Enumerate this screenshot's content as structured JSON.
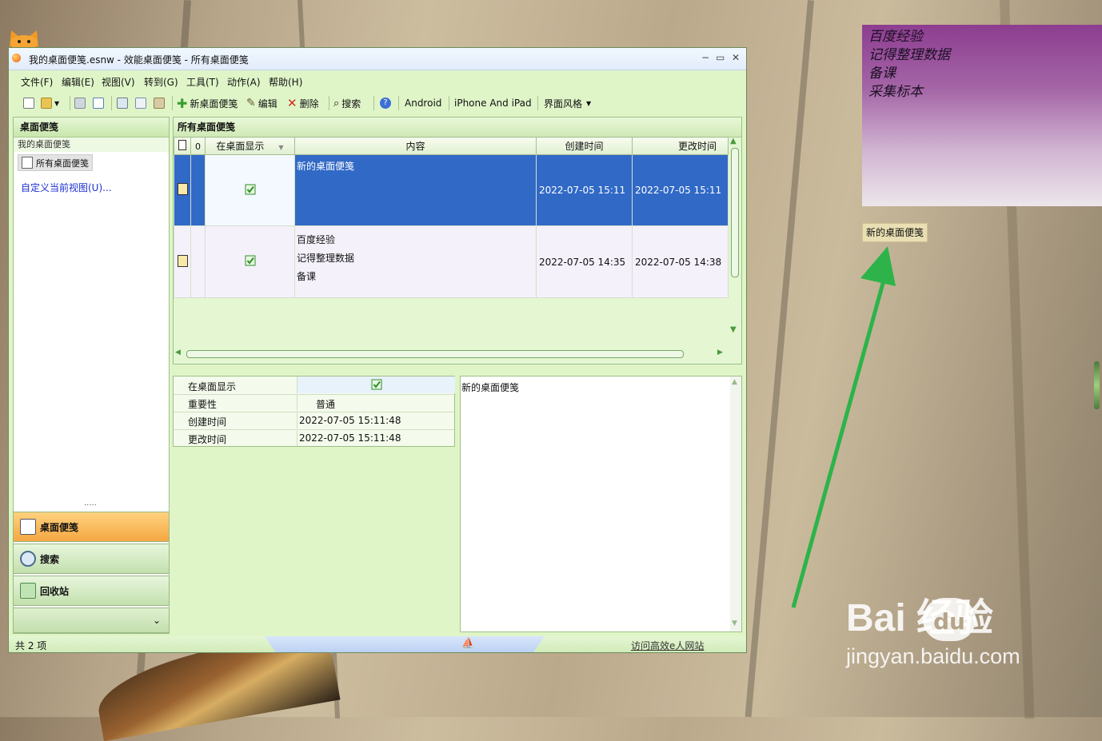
{
  "window": {
    "title": "我的桌面便笺.esnw - 效能桌面便笺 - 所有桌面便笺",
    "buttons": {
      "minimize": "−",
      "maximize": "▭",
      "close": "✕"
    }
  },
  "menu": [
    "文件(F)",
    "编辑(E)",
    "视图(V)",
    "转到(G)",
    "工具(T)",
    "动作(A)",
    "帮助(H)"
  ],
  "toolbar": {
    "new_label": "新桌面便笺",
    "edit_label": "编辑",
    "delete_label": "删除",
    "search_label": "搜索",
    "android_label": "Android",
    "iphone_label": "iPhone And iPad",
    "theme_label": "界面风格",
    "colors": {
      "new": "#3a9e2e",
      "delete": "#d62b1e",
      "help": "#3d6fd6"
    }
  },
  "nav": {
    "header": "桌面便笺",
    "group": "我的桌面便笺",
    "current": "所有桌面便笺",
    "customize_link": "自定义当前视图(U)...",
    "grip": "·····",
    "buttons": [
      {
        "label": "桌面便笺",
        "icon": "note-icon",
        "active": true
      },
      {
        "label": "搜索",
        "icon": "search-icon",
        "active": false
      },
      {
        "label": "回收站",
        "icon": "recycle-bin-icon",
        "active": false
      }
    ],
    "more_arrow": "⌄"
  },
  "panel": {
    "title": "所有桌面便笺",
    "columns": {
      "show": "在桌面显示",
      "content": "内容",
      "created": "创建时间",
      "modified": "更改时间"
    },
    "rows": [
      {
        "content": [
          "新的桌面便笺"
        ],
        "created": "2022-07-05 15:11",
        "modified": "2022-07-05 15:11",
        "show_on_desktop": true,
        "selected": true
      },
      {
        "content": [
          "百度经验",
          "记得整理数据",
          "备课"
        ],
        "created": "2022-07-05 14:35",
        "modified": "2022-07-05 14:38",
        "show_on_desktop": true,
        "selected": false
      }
    ]
  },
  "properties": {
    "rows": [
      {
        "key": "在桌面显示",
        "value": ""
      },
      {
        "key": "重要性",
        "value": "普通"
      },
      {
        "key": "创建时间",
        "value": "2022-07-05 15:11:48"
      },
      {
        "key": "更改时间",
        "value": "2022-07-05 15:11:48"
      }
    ]
  },
  "editor": {
    "text": "新的桌面便笺"
  },
  "status": {
    "count": "共 2 项",
    "link": "访问高效e人网站"
  },
  "desktop": {
    "note_lines": [
      "百度经验",
      "记得整理数据",
      "备课",
      "采集标本"
    ],
    "note_tag": "新的桌面便笺",
    "arrow_color": "#2db34a",
    "watermark_main": "Bai  经验",
    "watermark_du": "du",
    "watermark_sub": "jingyan.baidu.com"
  }
}
